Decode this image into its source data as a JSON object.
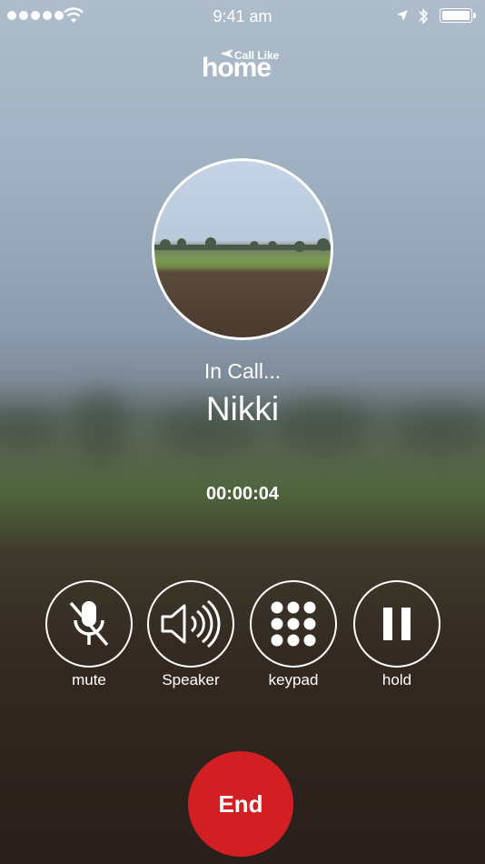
{
  "status_bar": {
    "time": "9:41 am"
  },
  "logo": {
    "small_text": "Call Like",
    "big_text": "home"
  },
  "call": {
    "status": "In Call...",
    "contact_name": "Nikki",
    "duration": "00:00:04"
  },
  "controls": [
    {
      "label": "mute",
      "icon": "microphone-muted-icon"
    },
    {
      "label": "Speaker",
      "icon": "speaker-icon"
    },
    {
      "label": "keypad",
      "icon": "keypad-icon"
    },
    {
      "label": "hold",
      "icon": "pause-icon"
    }
  ],
  "end_button": {
    "label": "End",
    "color": "#d21f24"
  }
}
